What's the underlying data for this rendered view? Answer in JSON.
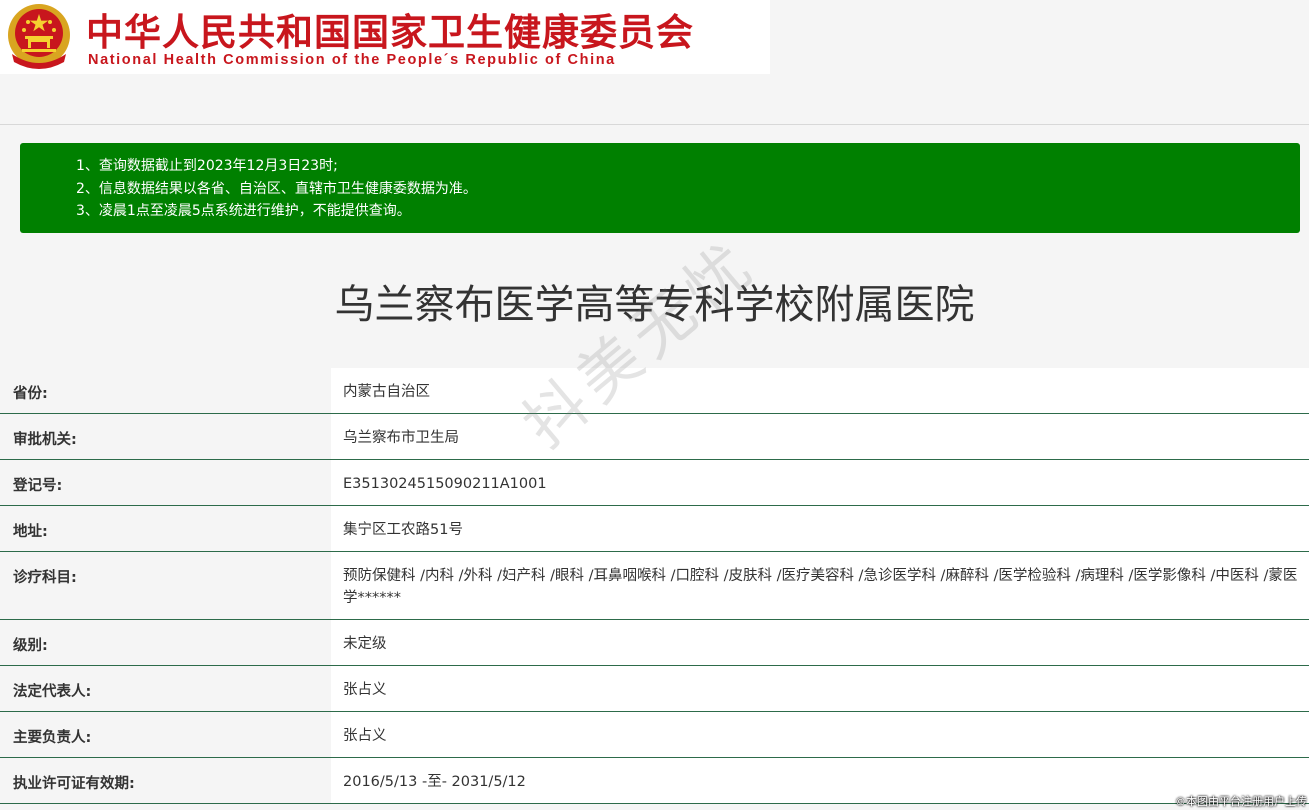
{
  "header": {
    "org_name_cn": "中华人民共和国国家卫生健康委员会",
    "org_name_en": "National Health Commission of the People´s Republic of China"
  },
  "notice": {
    "lines": [
      "1、查询数据截止到2023年12月3日23时;",
      "2、信息数据结果以各省、自治区、直辖市卫生健康委数据为准。",
      "3、凌晨1点至凌晨5点系统进行维护，不能提供查询。"
    ]
  },
  "hospital": {
    "name": "乌兰察布医学高等专科学校附属医院"
  },
  "fields": [
    {
      "label": "省份:",
      "value": "内蒙古自治区"
    },
    {
      "label": "审批机关:",
      "value": "乌兰察布市卫生局"
    },
    {
      "label": "登记号:",
      "value": "E3513024515090211A1001"
    },
    {
      "label": "地址:",
      "value": "集宁区工农路51号"
    },
    {
      "label": "诊疗科目:",
      "value": "预防保健科 /内科 /外科 /妇产科 /眼科 /耳鼻咽喉科 /口腔科 /皮肤科 /医疗美容科 /急诊医学科 /麻醉科 /医学检验科 /病理科 /医学影像科 /中医科 /蒙医学******"
    },
    {
      "label": "级别:",
      "value": "未定级"
    },
    {
      "label": "法定代表人:",
      "value": "张占义"
    },
    {
      "label": "主要负责人:",
      "value": "张占义"
    },
    {
      "label": "执业许可证有效期:",
      "value": "2016/5/13 -至- 2031/5/12"
    }
  ],
  "watermark": "抖美无忧",
  "credit": "©本图由平台注册用户上传",
  "colors": {
    "brand_red": "#c8161d",
    "notice_green": "#008000",
    "row_border": "#2d6b4a"
  },
  "icons": {
    "emblem": "national-emblem-icon"
  }
}
